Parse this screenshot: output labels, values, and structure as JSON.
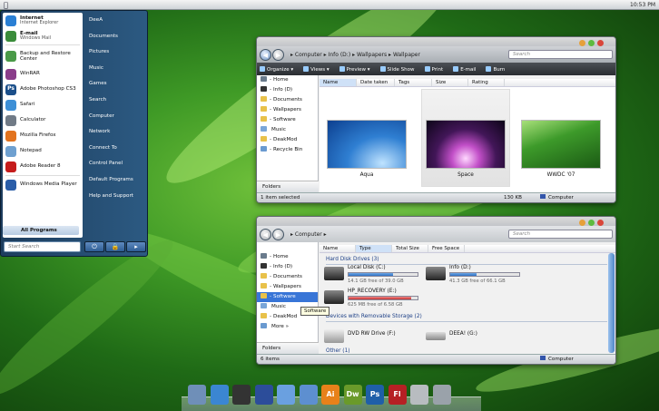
{
  "menubar": {
    "clock": "10:53 PM"
  },
  "start_menu": {
    "pinned": [
      {
        "title": "Internet",
        "subtitle": "Internet Explorer",
        "icon": "internet-explorer-icon",
        "color": "#2a7fd4"
      },
      {
        "title": "E-mail",
        "subtitle": "Windows Mail",
        "icon": "mail-icon",
        "color": "#3a8c3a"
      }
    ],
    "recent": [
      {
        "label": "Backup and Restore Center",
        "icon": "backup-icon",
        "color": "#4a9a48"
      },
      {
        "label": "WinRAR",
        "icon": "winrar-icon",
        "color": "#8a3d8a"
      },
      {
        "label": "Adobe Photoshop CS3",
        "icon": "photoshop-icon",
        "color": "#1b4f8a",
        "glyph": "Ps"
      },
      {
        "label": "Safari",
        "icon": "safari-icon",
        "color": "#3d8fd6"
      },
      {
        "label": "Calculator",
        "icon": "calculator-icon",
        "color": "#707a86"
      },
      {
        "label": "Mozilla Firefox",
        "icon": "firefox-icon",
        "color": "#e2731e"
      },
      {
        "label": "Notepad",
        "icon": "notepad-icon",
        "color": "#6ea0d0"
      },
      {
        "label": "Adobe Reader 8",
        "icon": "adobe-reader-icon",
        "color": "#c51c1c"
      },
      {
        "label": "Windows Media Player",
        "icon": "media-player-icon",
        "color": "#2a5da8"
      }
    ],
    "all_programs": "All Programs",
    "search_placeholder": "Start Search",
    "right": [
      "DeeA",
      "Documents",
      "Pictures",
      "Music",
      "Games",
      "Search",
      "Computer",
      "Network",
      "Connect To",
      "Control Panel",
      "Default Programs",
      "Help and Support"
    ]
  },
  "explorer1": {
    "crumbs": "▸ Computer ▸ Info (D:) ▸ Wallpapers ▸ Wallpaper",
    "search_placeholder": "Search",
    "toolbar": [
      "Organize ▾",
      "Views ▾",
      "Preview ▾",
      "Slide Show",
      "Print",
      "E-mail",
      "Burn"
    ],
    "nav": [
      "Home",
      "Info (D)",
      "Documents",
      "Wallpapers",
      "Software",
      "Music",
      "DeakMod",
      "Recycle Bin"
    ],
    "nav_prefix": [
      "-",
      "-",
      "-",
      "-",
      "-",
      "",
      "-",
      "-"
    ],
    "folders": "Folders",
    "columns": [
      "Name",
      "Date taken",
      "Tags",
      "Size",
      "Rating"
    ],
    "thumbs": [
      "Aqua",
      "Space",
      "WWDC '07"
    ],
    "status_left": "1 item selected",
    "status_mid": "130 KB",
    "status_right": "Computer"
  },
  "explorer2": {
    "crumbs": "▸ Computer ▸",
    "search_placeholder": "Search",
    "nav": [
      "Home",
      "Info (D)",
      "Documents",
      "Wallpapers",
      "Software",
      "Music",
      "DeakMod",
      "More »"
    ],
    "nav_prefix": [
      "-",
      "-",
      "-",
      "-",
      "-",
      "",
      "-",
      ""
    ],
    "folders": "Folders",
    "columns": [
      "Name",
      "Type",
      "Total Size",
      "Free Space"
    ],
    "group_hdd": "Hard Disk Drives (3)",
    "group_removable": "Devices with Removable Storage (2)",
    "group_other": "Other (1)",
    "drives": [
      {
        "name": "Local Disk (C:)",
        "free": "14.1 GB free of 39.0 GB",
        "used": 0.64
      },
      {
        "name": "Info (D:)",
        "free": "41.3 GB free of 66.1 GB",
        "used": 0.38
      },
      {
        "name": "HP_RECOVERY (E:)",
        "free": "625 MB free of 6.58 GB",
        "used": 0.91
      }
    ],
    "removable": [
      "DVD RW Drive (F:)",
      "DEEA! (G:)"
    ],
    "tooltip": "Software",
    "status_left": "6 items",
    "status_right": "Computer"
  },
  "dock": [
    {
      "icon": "finder-icon",
      "color": "#6f8fb8",
      "glyph": ""
    },
    {
      "icon": "safari-dock-icon",
      "color": "#3b86d2",
      "glyph": ""
    },
    {
      "icon": "film-icon",
      "color": "#333",
      "glyph": ""
    },
    {
      "icon": "pen-tool-icon",
      "color": "#2c4d9a",
      "glyph": ""
    },
    {
      "icon": "itunes-icon",
      "color": "#6aa0e0",
      "glyph": ""
    },
    {
      "icon": "app-store-icon",
      "color": "#5d8fd0",
      "glyph": ""
    },
    {
      "icon": "illustrator-icon",
      "color": "#e7811a",
      "glyph": "Ai"
    },
    {
      "icon": "dreamweaver-icon",
      "color": "#6a9a2a",
      "glyph": "Dw"
    },
    {
      "icon": "photoshop-dock-icon",
      "color": "#1f5fa8",
      "glyph": "Ps"
    },
    {
      "icon": "flash-icon",
      "color": "#b62024",
      "glyph": "Fl"
    },
    {
      "icon": "blank-app-icon",
      "color": "#b8bcc0",
      "glyph": ""
    },
    {
      "icon": "trash-icon",
      "color": "#9aa2aa",
      "glyph": ""
    }
  ]
}
